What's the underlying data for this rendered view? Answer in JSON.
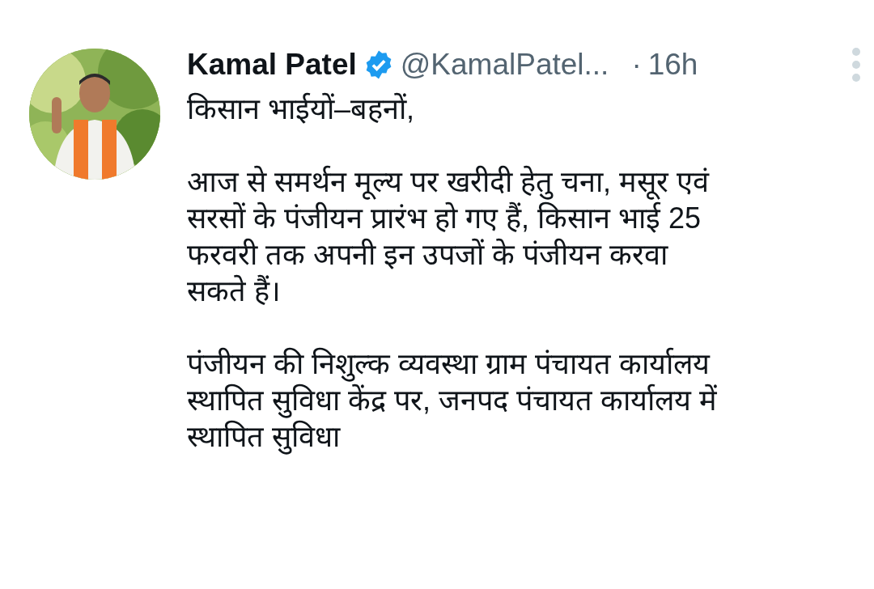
{
  "tweet": {
    "author": {
      "name": "Kamal Patel",
      "verified": true,
      "handle": "@KamalPatel...",
      "separator": "·",
      "time": "16h"
    },
    "paragraphs": [
      "किसान भाईयों–बहनों,",
      "आज से समर्थन मूल्य पर खरीदी हेतु चना, मसूर एवं\nसरसों के पंजीयन प्रारंभ हो गए हैं, किसान भाई 25\nफरवरी तक अपनी इन उपजों के पंजीयन करवा\nसकते हैं।",
      "पंजीयन की निशुल्क व्यवस्था ग्राम पंचायत कार्यालय\nस्थापित सुविधा केंद्र पर, जनपद पंचायत कार्यालय में\nस्थापित सुविधा"
    ]
  }
}
